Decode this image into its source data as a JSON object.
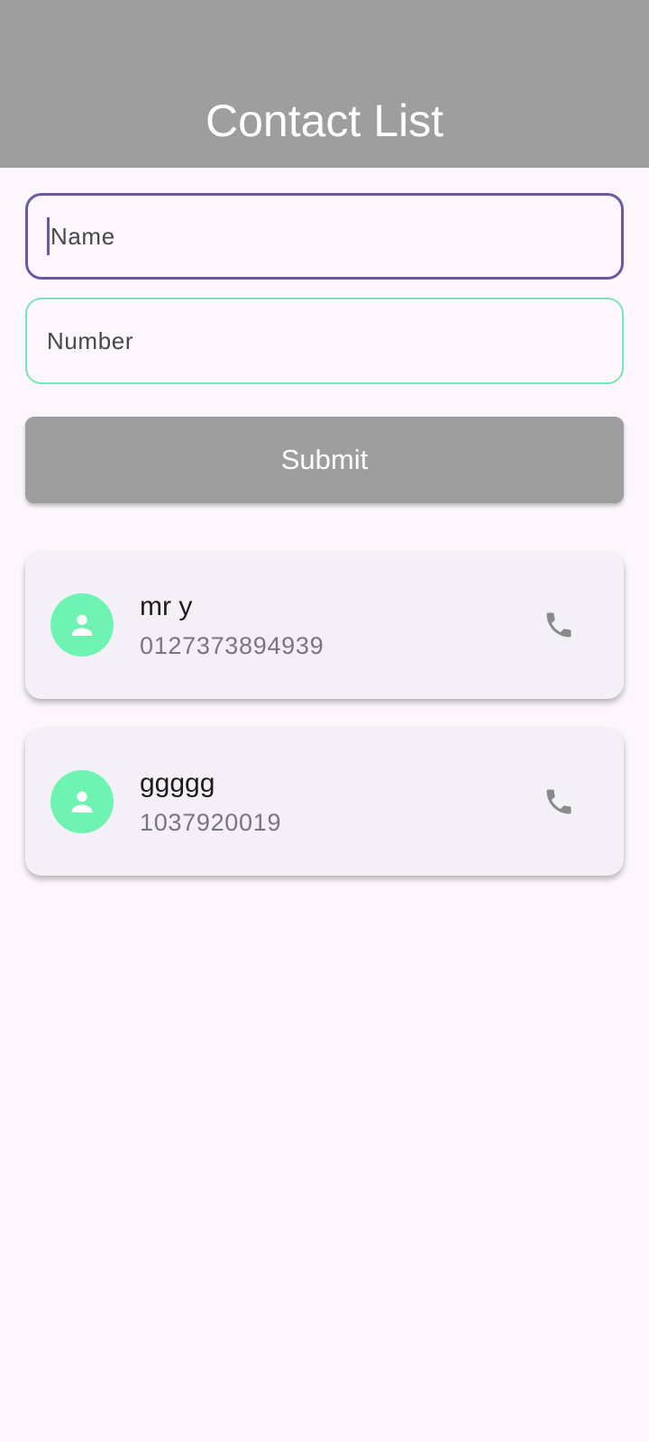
{
  "app_bar": {
    "title": "Contact List"
  },
  "form": {
    "name_placeholder": "Name",
    "number_placeholder": "Number",
    "submit_label": "Submit"
  },
  "contacts": [
    {
      "name": "mr y",
      "number": "0127373894939",
      "avatar_icon": "person-icon",
      "action_icon": "phone-icon"
    },
    {
      "name": "ggggg",
      "number": "1037920019",
      "avatar_icon": "person-icon",
      "action_icon": "phone-icon"
    }
  ],
  "colors": {
    "app_bar": "#9e9e9e",
    "background": "#fdf7fd",
    "focused_border": "#6a58a2",
    "field_border": "#7be3b5",
    "avatar": "#6ff3b3",
    "card": "#f4f0f7"
  }
}
